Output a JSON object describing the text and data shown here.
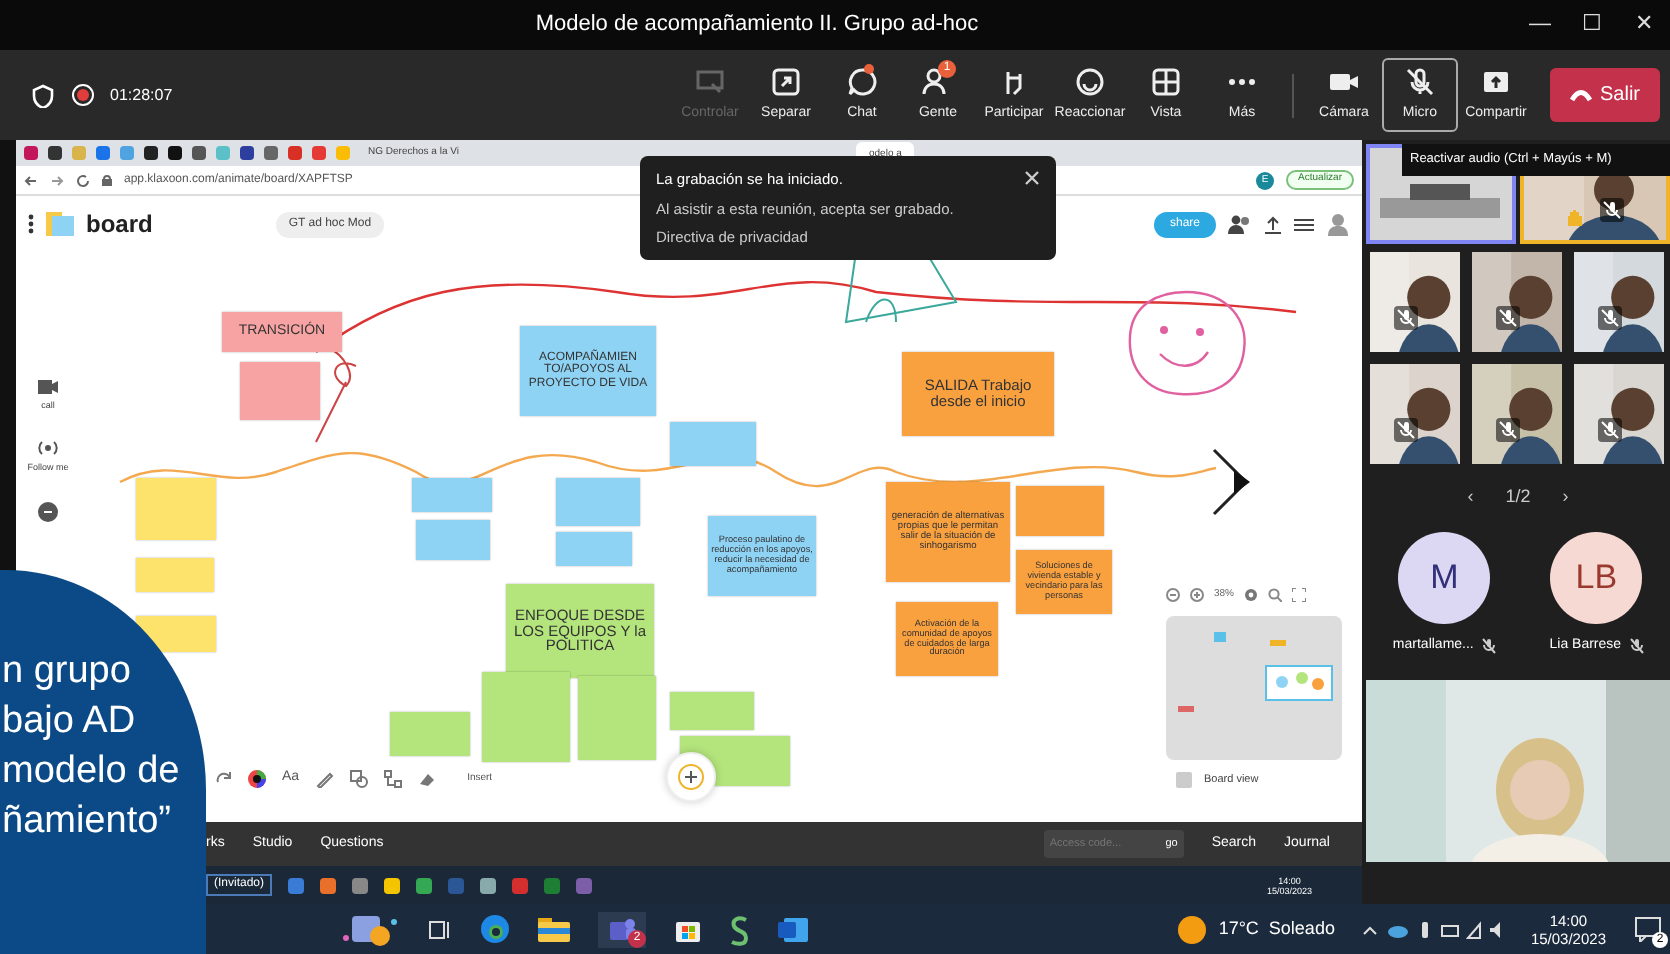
{
  "window": {
    "title": "Modelo de acompañamiento II. Grupo ad-hoc",
    "controls": [
      "—",
      "☐",
      "✕"
    ]
  },
  "meeting_bar": {
    "recording": true,
    "timer": "01:28:07",
    "tools": [
      {
        "label": "Controlar",
        "disabled": true
      },
      {
        "label": "Separar",
        "disabled": false
      },
      {
        "label": "Chat",
        "disabled": false,
        "dot": true
      },
      {
        "label": "Gente",
        "disabled": false,
        "badge": "1"
      },
      {
        "label": "Participar",
        "disabled": false
      },
      {
        "label": "Reaccionar",
        "disabled": false
      },
      {
        "label": "Vista",
        "disabled": false
      },
      {
        "label": "Más",
        "disabled": false
      },
      {
        "label": "Cámara",
        "disabled": false
      },
      {
        "label": "Micro",
        "disabled": false,
        "selected": true
      },
      {
        "label": "Compartir",
        "disabled": false
      }
    ],
    "leave": "Salir"
  },
  "browser": {
    "pinned_tabs": [
      {
        "color": "#c2185b"
      },
      {
        "color": "#333333"
      },
      {
        "color": "#d9b44a"
      },
      {
        "color": "#1a73e8"
      },
      {
        "color": "#4fa3e0"
      },
      {
        "color": "#222222"
      },
      {
        "color": "#111111"
      },
      {
        "color": "#555555"
      },
      {
        "color": "#5bc0c8"
      },
      {
        "color": "#2c3e9e"
      },
      {
        "color": "#666666"
      },
      {
        "color": "#d93025"
      },
      {
        "color": "#e53935"
      },
      {
        "color": "#fbbc05"
      }
    ],
    "tabs": [
      {
        "label": "NG Derechos a la Vi",
        "selected": false
      },
      {
        "label": "odelo a",
        "selected": true
      }
    ],
    "url": "app.klaxoon.com/animate/board/XAPFTSP",
    "update_button": "Actualizar",
    "profile": "E"
  },
  "board": {
    "logo": "board",
    "title": "GT ad hoc Mod",
    "share": "share",
    "side_tools": [
      "call",
      "Follow me"
    ],
    "notes": [
      {
        "color": "#f7a3a3",
        "text": "TRANSICIÓN"
      },
      {
        "color": "#f7a3a3"
      },
      {
        "color": "#8fd3f4",
        "text": "ACOMPAÑAMIEN TO/APOYOS AL PROYECTO DE VIDA"
      },
      {
        "color": "#f9a03f",
        "text": "SALIDA Trabajo desde el inicio"
      },
      {
        "color": "#8fd3f4"
      },
      {
        "color": "#fde36b"
      },
      {
        "color": "#fde36b"
      },
      {
        "color": "#fde36b"
      },
      {
        "color": "#8fd3f4"
      },
      {
        "color": "#8fd3f4"
      },
      {
        "color": "#8fd3f4"
      },
      {
        "color": "#8fd3f4"
      },
      {
        "color": "#8fd3f4",
        "text": "Proceso paulatino de reducción en los apoyos, reducir la necesidad de acompañamiento"
      },
      {
        "color": "#b4e57c",
        "text": "ENFOQUE DESDE LOS EQUIPOS Y la POLITICA"
      },
      {
        "color": "#b4e57c"
      },
      {
        "color": "#b4e57c"
      },
      {
        "color": "#b4e57c"
      },
      {
        "color": "#b4e57c"
      },
      {
        "color": "#b4e57c"
      },
      {
        "color": "#f9a03f",
        "text": "generación de alternativas propias que le permitan salir de la situación de sinhogarismo"
      },
      {
        "color": "#f9a03f"
      },
      {
        "color": "#f9a03f",
        "text": "Soluciones de vivienda estable y vecindario para las personas"
      },
      {
        "color": "#f9a03f",
        "text": "Activación de la comunidad de apoyos de cuidados de larga duración"
      }
    ],
    "zoom": "38%",
    "board_view": "Board view",
    "text_tool": "Aa",
    "insert": "Insert"
  },
  "toast": {
    "title": "La grabación se ha iniciado.",
    "text": "Al asistir a esta reunión, acepta ser grabado.",
    "link": "Directiva de privacidad"
  },
  "remote_bar": {
    "items": [
      "rks",
      "Studio",
      "Questions"
    ],
    "access_placeholder": "Access code...",
    "go": "go",
    "search": "Search",
    "journal": "Journal"
  },
  "remote_taskbar": {
    "guest": "(Invitado)",
    "time": "14:00",
    "date": "15/03/2023"
  },
  "overlay_lines": [
    "n grupo",
    "bajo AD",
    "modelo de",
    "ñamiento”"
  ],
  "side_panel": {
    "tooltip": "Reactivar audio (Ctrl + Mayús + M)",
    "tiles": [
      {
        "selected": true,
        "hand_raised": false,
        "muted": false
      },
      {
        "selected": false,
        "hand_raised": true,
        "muted": true
      },
      {
        "selected": false,
        "hand_raised": false,
        "muted": true
      },
      {
        "selected": false,
        "hand_raised": false,
        "muted": true
      },
      {
        "selected": false,
        "hand_raised": false,
        "muted": true
      },
      {
        "selected": false,
        "hand_raised": false,
        "muted": true
      },
      {
        "selected": false,
        "hand_raised": false,
        "muted": true
      },
      {
        "selected": false,
        "hand_raised": false,
        "muted": true
      }
    ],
    "pager": {
      "prev": "‹",
      "label": "1/2",
      "next": "›"
    },
    "participants": [
      {
        "initials": "M",
        "name": "martallame...",
        "color": "#dcd8f3",
        "muted": true
      },
      {
        "initials": "LB",
        "name": "Lia Barrese",
        "color": "#f6d9d2",
        "muted": true
      }
    ]
  },
  "taskbar": {
    "teams_badge": "2",
    "weather": "17°C  Soleado",
    "time": "14:00",
    "date": "15/03/2023",
    "notifications": "2"
  }
}
